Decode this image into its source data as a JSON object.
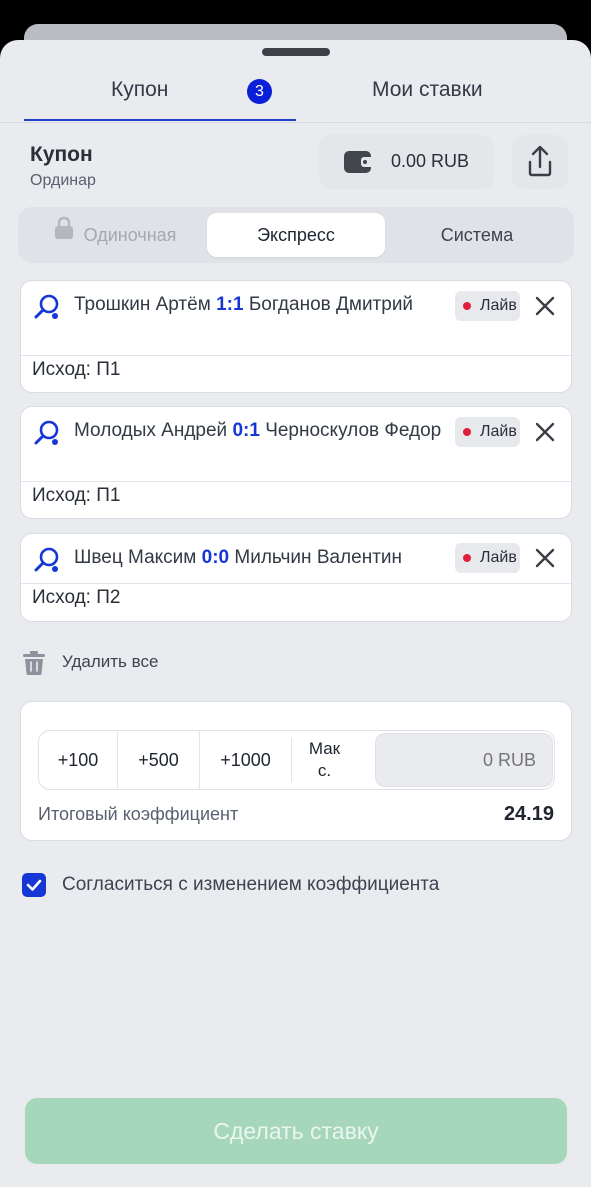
{
  "tabs": {
    "coupon_label": "Купон",
    "coupon_badge": "3",
    "my_bets_label": "Мои ставки"
  },
  "coupon": {
    "title": "Купон",
    "subtitle": "Ординар"
  },
  "wallet": {
    "amount": "0.00 RUB"
  },
  "bet_types": {
    "single": "Одиночная",
    "express": "Экспресс",
    "system": "Система",
    "selected": "Экспресс"
  },
  "bets": [
    {
      "player1": "Трошкин Артём",
      "score": "1:1",
      "player2": "Богданов Дмитрий",
      "live": "Лайв",
      "outcome_label": "Исход:",
      "outcome": "П1"
    },
    {
      "player1": "Молодых Андрей",
      "score": "0:1",
      "player2": "Черноскулов Федор",
      "live": "Лайв",
      "outcome_label": "Исход:",
      "outcome": "П1"
    },
    {
      "player1": "Швец Максим",
      "score": "0:0",
      "player2": "Мильчин Валентин",
      "live": "Лайв",
      "outcome_label": "Исход:",
      "outcome": "П2"
    }
  ],
  "delete_all": "Удалить все",
  "stake": {
    "chips": [
      "+100",
      "+500",
      "+1000"
    ],
    "max_label_1": "Мак",
    "max_label_2": "с.",
    "placeholder": "0 RUB",
    "total_coef_label": "Итоговый коэффициент",
    "total_coef_value": "24.19"
  },
  "agreement": {
    "label": "Согласиться с изменением коэффициента",
    "checked": true
  },
  "submit_label": "Сделать ставку",
  "colors": {
    "accent": "#1637d6",
    "live_dot": "#e0203a",
    "submit_disabled": "#a6d7bb"
  },
  "icons": {
    "sport": "table-tennis-icon",
    "wallet": "wallet-icon",
    "share": "share-icon",
    "lock": "lock-icon",
    "trash": "trash-icon",
    "close": "close-icon",
    "check": "check-icon"
  }
}
